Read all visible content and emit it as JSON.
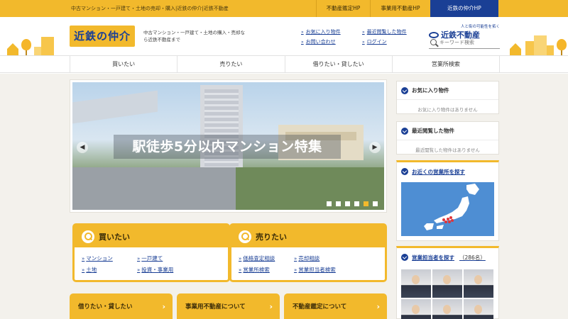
{
  "topbar": {
    "tagline": "中古マンション・一戸建て・土地の売却・購入|近鉄の仲介|近鉄不動産",
    "links": [
      {
        "label": "不動産鑑定HP"
      },
      {
        "label": "事業用不動産HP"
      },
      {
        "label": "近鉄の仲介HP"
      }
    ],
    "active_color": "#1a3f95",
    "accent_color": "#f2b92c"
  },
  "header": {
    "logo": "近鉄の仲介",
    "description": "中古マンション・一戸建て・土地の購入・売却なら近鉄不動産まで",
    "links": [
      {
        "label": "お気に入り物件"
      },
      {
        "label": "最近閲覧した物件"
      },
      {
        "label": "お問い合わせ"
      },
      {
        "label": "ログイン"
      }
    ],
    "corp_tagline": "人と街の可能性を拓く",
    "corp_name": "近鉄不動産",
    "search_placeholder": "キーワード検索"
  },
  "nav": {
    "items": [
      {
        "label": "買いたい"
      },
      {
        "label": "売りたい"
      },
      {
        "label": "借りたい・貸したい"
      },
      {
        "label": "営業所検索"
      }
    ]
  },
  "slider": {
    "caption": "駅徒歩5分以内マンション特集",
    "prev_icon": "chevron-left-icon",
    "next_icon": "chevron-right-icon",
    "dot_count": 6,
    "active_dot": 5
  },
  "quick": {
    "buy": {
      "title": "買いたい",
      "links": [
        {
          "label": "マンション"
        },
        {
          "label": "一戸建て"
        },
        {
          "label": "土地"
        },
        {
          "label": "投資・事業用"
        }
      ]
    },
    "sell": {
      "title": "売りたい",
      "links": [
        {
          "label": "価格査定相談"
        },
        {
          "label": "売却相談"
        },
        {
          "label": "営業所検索"
        },
        {
          "label": "営業担当者検索"
        }
      ]
    }
  },
  "bottom_buttons": [
    {
      "label": "借りたい・貸したい"
    },
    {
      "label": "事業用不動産について"
    },
    {
      "label": "不動産鑑定について"
    }
  ],
  "sidebar": {
    "favorites": {
      "title": "お気に入り物件",
      "empty": "お気に入り物件はありません"
    },
    "recent": {
      "title": "最近閲覧した物件",
      "empty": "最近閲覧した物件はありません"
    },
    "nearby": {
      "title": "お近くの営業所を探す"
    },
    "staff": {
      "title": "営業担当者を探す",
      "count": "（286名）"
    }
  }
}
